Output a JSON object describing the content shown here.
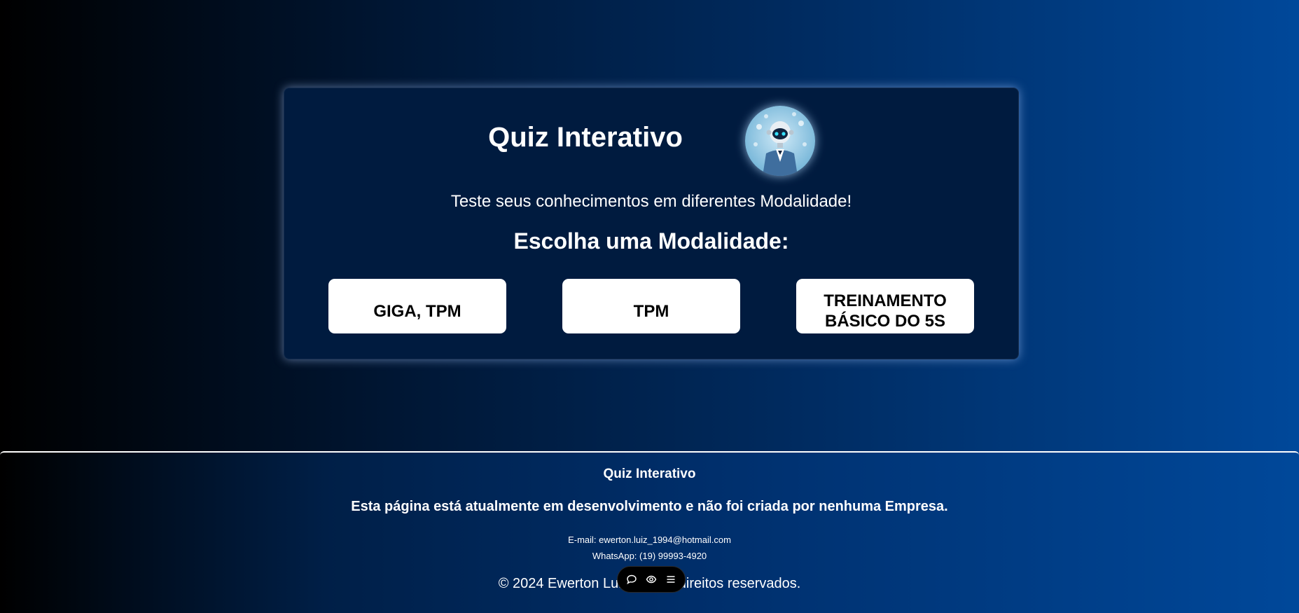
{
  "card": {
    "title": "Quiz Interativo",
    "subtitle": "Teste seus conhecimentos em diferentes Modalidade!",
    "choose_heading": "Escolha uma Modalidade:",
    "modes": [
      {
        "label": "GIGA, TPM"
      },
      {
        "label": "TPM"
      },
      {
        "label": "TREINAMENTO BÁSICO DO 5S"
      }
    ],
    "avatar_icon": "robot-avatar-icon"
  },
  "footer": {
    "title": "Quiz Interativo",
    "notice": "Esta página está atualmente em desenvolvimento e não foi criada por nenhuma Empresa.",
    "email": "E-mail: ewerton.luiz_1994@hotmail.com",
    "whatsapp": "WhatsApp: (19) 99993-4920",
    "copyright": "© 2024 Ewerton Luiz e ... os direitos reservados."
  },
  "toolbar": {
    "icons": [
      "comment-icon",
      "eye-icon",
      "menu-icon"
    ]
  },
  "colors": {
    "card_bg": "#001b3f",
    "button_bg": "#ffffff",
    "gradient_end": "#00489a"
  }
}
